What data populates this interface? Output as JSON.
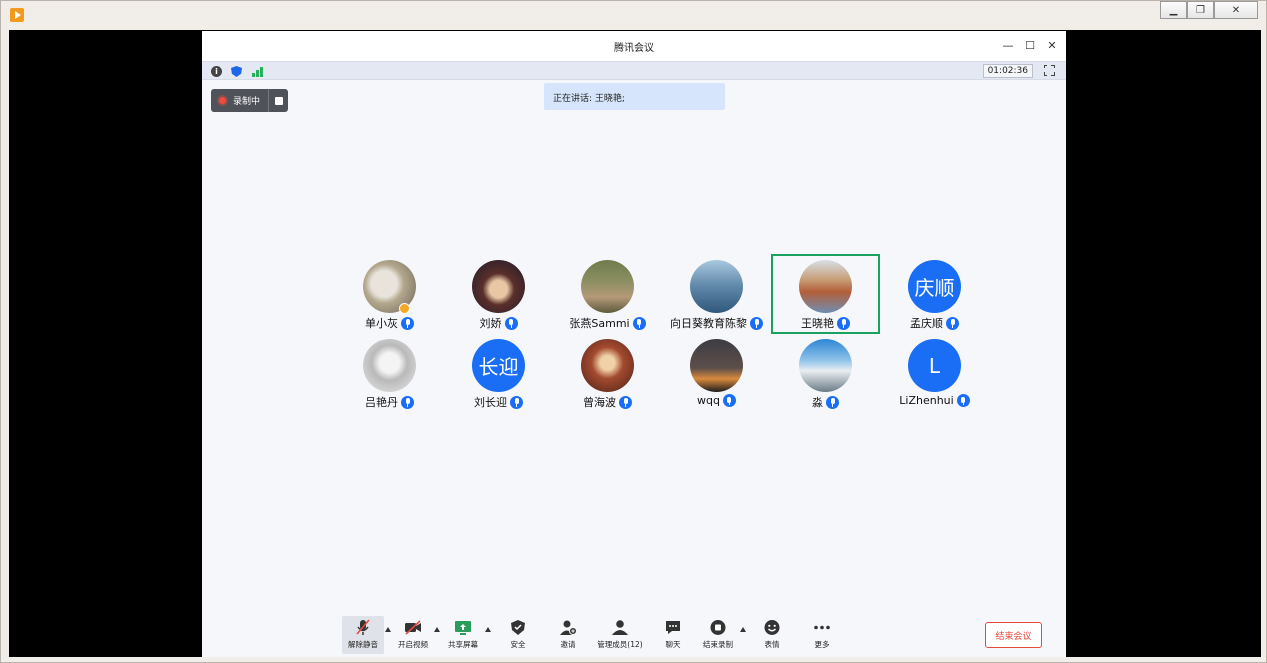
{
  "window": {
    "title": "腾讯会议",
    "duration": "01:02:36",
    "recording_label": "录制中",
    "speaking_text": "正在讲话: 王晓艳;"
  },
  "participants": [
    {
      "name": "单小灰",
      "avatar": "photo"
    },
    {
      "name": "刘娇",
      "avatar": "photo"
    },
    {
      "name": "张燕Sammi",
      "avatar": "photo"
    },
    {
      "name": "向日葵教育陈黎",
      "avatar": "photo"
    },
    {
      "name": "王晓艳",
      "avatar": "photo",
      "speaking": true
    },
    {
      "name": "孟庆顺",
      "avatar_text": "庆顺"
    },
    {
      "name": "吕艳丹",
      "avatar": "photo"
    },
    {
      "name": "刘长迎",
      "avatar_text": "长迎"
    },
    {
      "name": "曾海波",
      "avatar": "photo"
    },
    {
      "name": "wqq",
      "avatar": "photo"
    },
    {
      "name": "淼",
      "avatar": "photo"
    },
    {
      "name": "LiZhenhui",
      "avatar_text": "L"
    }
  ],
  "toolbar": {
    "unmute": "解除静音",
    "video": "开启视频",
    "share": "共享屏幕",
    "security": "安全",
    "invite": "邀请",
    "members": "管理成员(12)",
    "chat": "聊天",
    "stop_recording": "结束录制",
    "reactions": "表情",
    "more": "更多",
    "end_meeting": "结束会议"
  },
  "colors": {
    "accent": "#1a6ef5",
    "speaking_border": "#1aa260",
    "end_button": "#e64a3b",
    "recording_dot": "#f04a3c"
  }
}
